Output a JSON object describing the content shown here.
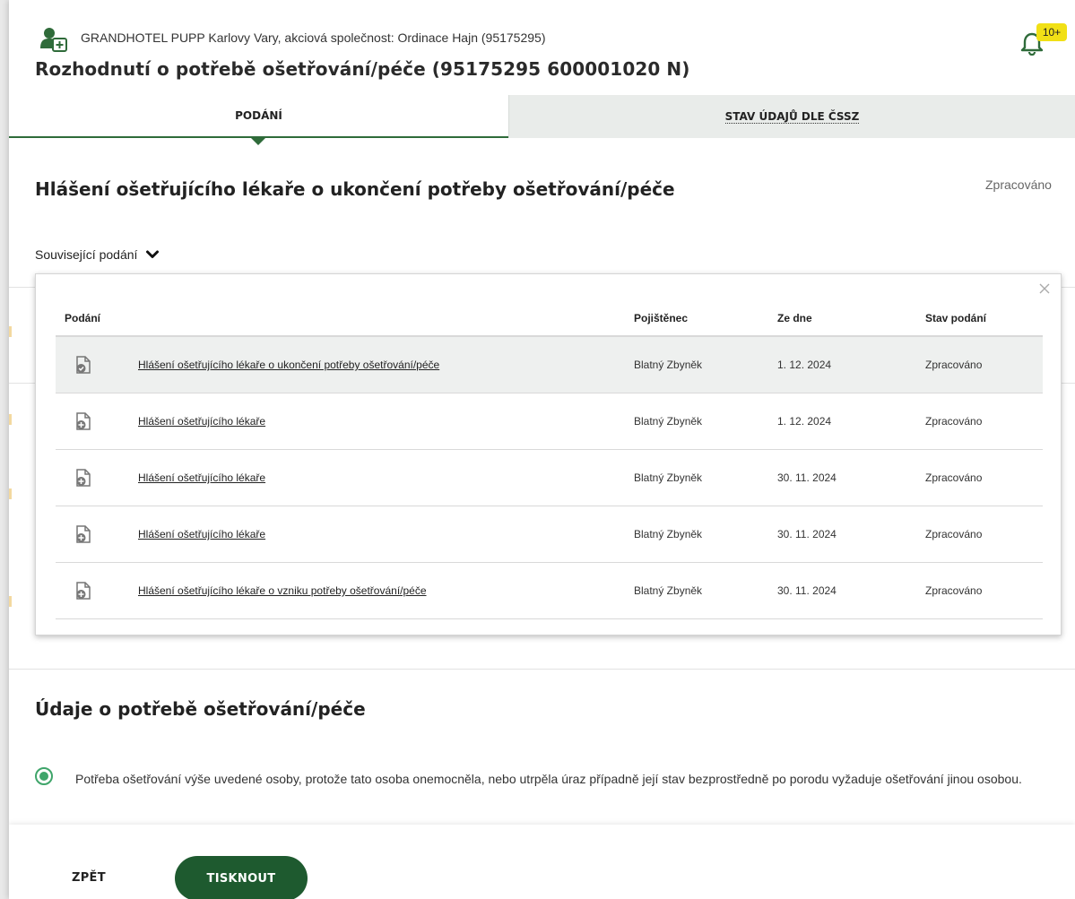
{
  "header": {
    "org_name": "GRANDHOTEL PUPP Karlovy Vary, akciová společnost: Ordinace Hajn (95175295)",
    "title": "Rozhodnutí o potřebě ošetřování/péče (95175295 600001020 N)",
    "notification_count": "10+",
    "org_icon": "user-add-icon",
    "notification_icon": "bell-icon"
  },
  "tabs": [
    {
      "label": "PODÁNÍ",
      "active": true
    },
    {
      "label": "STAV ÚDAJŮ DLE ČSSZ",
      "active": false
    }
  ],
  "section": {
    "title": "Hlášení ošetřujícího lékaře o ukončení potřeby ošetřování/péče",
    "status": "Zpracováno",
    "related_label": "Související podání"
  },
  "related_table": {
    "columns": [
      "Podání",
      "Pojištěnec",
      "Ze dne",
      "Stav podání"
    ],
    "rows": [
      {
        "podani": "Hlášení ošetřujícího lékaře o ukončení potřeby ošetřování/péče",
        "pojistenec": "Blatný Zbyněk",
        "date": "1. 12. 2024",
        "stav": "Zpracováno",
        "icon": "document-check-icon"
      },
      {
        "podani": "Hlášení ošetřujícího lékaře",
        "pojistenec": "Blatný Zbyněk",
        "date": "1. 12. 2024",
        "stav": "Zpracováno",
        "icon": "document-add-icon"
      },
      {
        "podani": "Hlášení ošetřujícího lékaře",
        "pojistenec": "Blatný Zbyněk",
        "date": "30. 11. 2024",
        "stav": "Zpracováno",
        "icon": "document-add-icon"
      },
      {
        "podani": "Hlášení ošetřujícího lékaře",
        "pojistenec": "Blatný Zbyněk",
        "date": "30. 11. 2024",
        "stav": "Zpracováno",
        "icon": "document-add-icon"
      },
      {
        "podani": "Hlášení ošetřujícího lékaře o vzniku potřeby ošetřování/péče",
        "pojistenec": "Blatný Zbyněk",
        "date": "30. 11. 2024",
        "stav": "Zpracováno",
        "icon": "document-add-icon"
      }
    ]
  },
  "details": {
    "title": "Údaje o potřebě ošetřování/péče",
    "option_text": "Potřeba ošetřování výše uvedené osoby, protože tato osoba onemocněla, nebo utrpěla úraz případně její stav bezprostředně po porodu vyžaduje ošetřování jinou osobou.",
    "option_selected": true
  },
  "footer": {
    "back_label": "ZPĚT",
    "print_label": "TISKNOUT"
  },
  "colors": {
    "brand_green": "#1e5a2f",
    "tab_underline": "#2f6b3a",
    "radio_green": "#3fa56a",
    "badge_yellow": "#f1e016"
  }
}
